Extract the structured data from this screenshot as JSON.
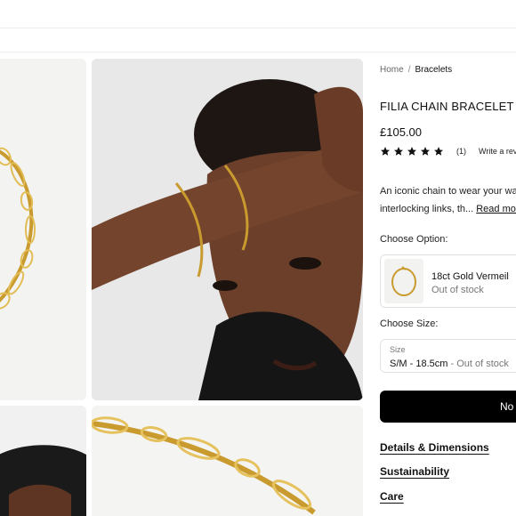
{
  "breadcrumb": {
    "home": "Home",
    "separator": "/",
    "current": "Bracelets"
  },
  "product": {
    "title": "FILIA CHAIN BRACELET",
    "price": "£105.00",
    "rating": {
      "stars": 5,
      "count": "(1)",
      "write_review": "Write a rev"
    },
    "description_line1": "An iconic chain to wear your wa",
    "description_line2": "interlocking links, th...",
    "read_more": "Read mor"
  },
  "option": {
    "label": "Choose Option:",
    "name": "18ct Gold Vermeil",
    "stock": "Out of stock"
  },
  "size": {
    "label": "Choose Size:",
    "caption": "Size",
    "value": "S/M - 18.5cm",
    "separator": " - ",
    "stock": "Out of stock"
  },
  "cta": {
    "label": "No"
  },
  "accordion": [
    "Details & Dimensions",
    "Sustainability",
    "Care"
  ],
  "colors": {
    "gold": "#c99a2e",
    "skin": "#6b3f2a",
    "button": "#000000"
  }
}
